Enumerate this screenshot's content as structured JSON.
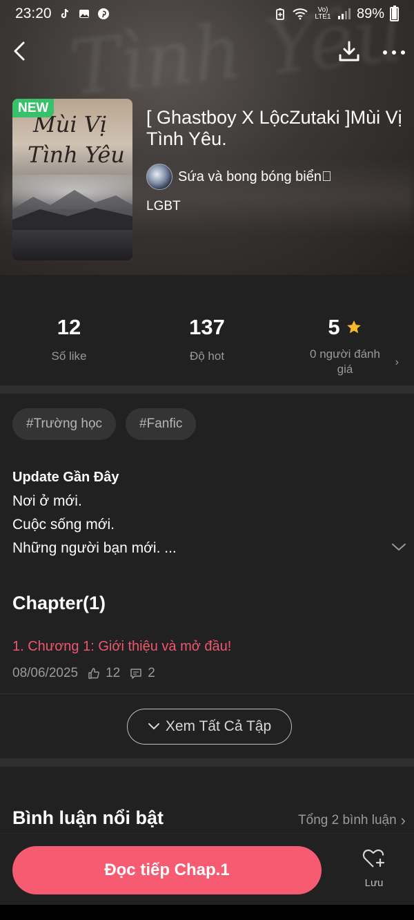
{
  "status_bar": {
    "time": "23:20",
    "network_label": "Vo) LTE1",
    "battery": "89%",
    "battery_level": 0.89
  },
  "nav": {
    "back_icon": "chevron-left-icon",
    "download_icon": "download-icon",
    "more_icon": "more-horizontal-icon"
  },
  "book": {
    "badge": "NEW",
    "cover_title_line1": "Mùi Vị",
    "cover_title_line2": "Tình Yêu",
    "title": "[ Ghastboy X LộcZutaki ]Mùi Vị Tình Yêu.",
    "author": "Sứa và bong bóng biển\u0000",
    "genre": "LGBT"
  },
  "stats": {
    "likes_value": "12",
    "likes_label": "Số like",
    "hot_value": "137",
    "hot_label": "Độ hot",
    "rating_value": "5",
    "rating_label": "0 người đánh giá"
  },
  "tags": [
    "#Trường học",
    "#Fanfic"
  ],
  "update": {
    "title": "Update Gần Đây",
    "lines": [
      "Nơi ở mới.",
      "Cuộc sống mới.",
      "Những người bạn mới. ..."
    ]
  },
  "chapters": {
    "heading": "Chapter(1)",
    "items": [
      {
        "title": "1. Chương 1: Giới thiệu và mở đầu!",
        "date": "08/06/2025",
        "likes": "12",
        "comments": "2"
      }
    ],
    "view_all_label": "Xem Tất Cả Tập"
  },
  "comments": {
    "heading": "Bình luận nổi bật",
    "total_label": "Tổng 2 bình luận"
  },
  "bottom": {
    "read_button": "Đọc tiếp Chap.1",
    "save_label": "Lưu"
  },
  "colors": {
    "accent": "#f65b71",
    "chapter_link": "#f0566f",
    "badge_new": "#39c06a",
    "star": "#f7b82e",
    "panel": "#212121"
  }
}
